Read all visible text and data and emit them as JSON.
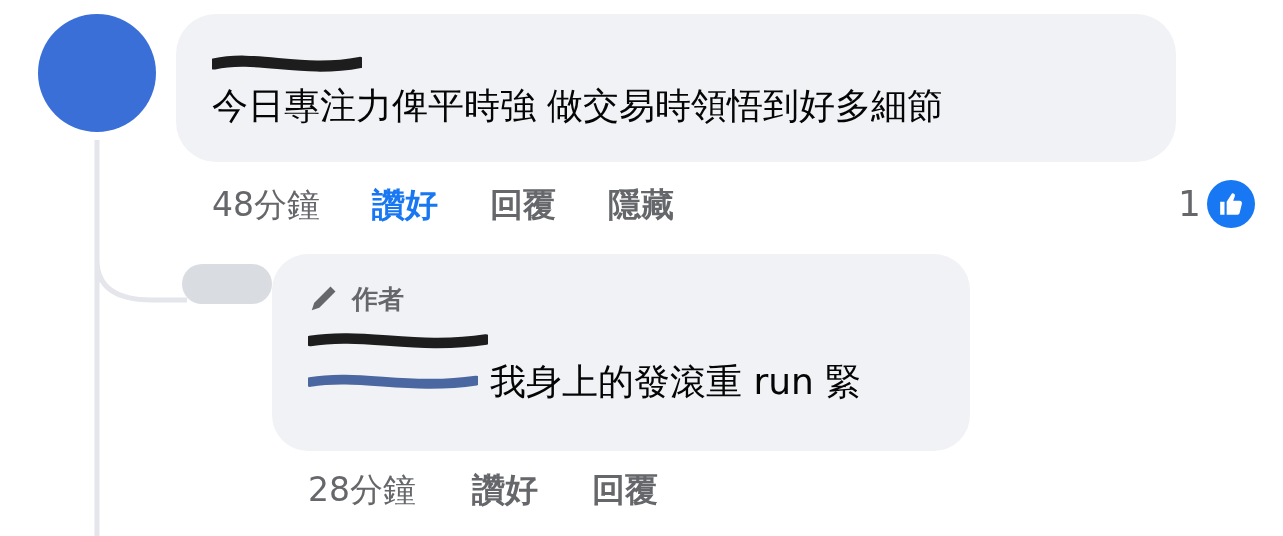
{
  "comments": [
    {
      "text": "今日專注力俾平時強 做交易時領悟到好多細節",
      "time": "48分鐘",
      "actions": [
        {
          "label": "讚好",
          "selected": true
        },
        {
          "label": "回覆",
          "selected": false
        },
        {
          "label": "隱藏",
          "selected": false
        }
      ],
      "reaction_count": "1",
      "replies": [
        {
          "badge": "作者",
          "text": "我身上的發滾重 run 緊",
          "time": "28分鐘",
          "actions": [
            {
              "label": "讚好",
              "selected": false
            },
            {
              "label": "回覆",
              "selected": false
            }
          ]
        }
      ]
    }
  ]
}
